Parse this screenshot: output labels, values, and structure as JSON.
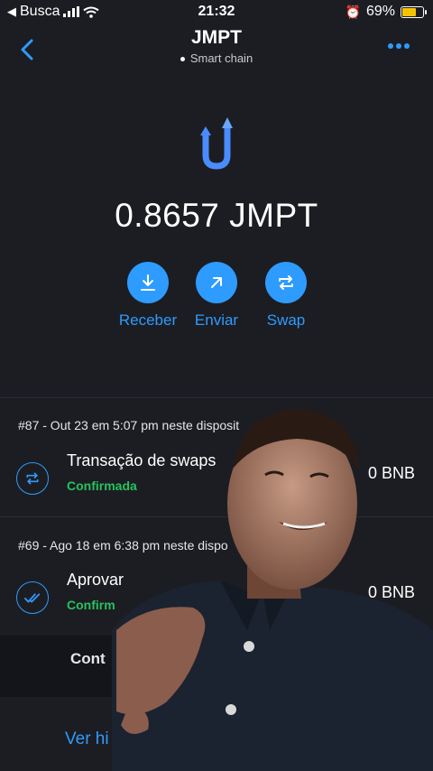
{
  "status_bar": {
    "carrier": "Busca",
    "time": "21:32",
    "battery": "69%"
  },
  "header": {
    "title": "JMPT",
    "subtitle": "Smart chain"
  },
  "balance": {
    "amount": "0.8657 JMPT"
  },
  "actions": {
    "receive": "Receber",
    "send": "Enviar",
    "swap": "Swap"
  },
  "transactions": [
    {
      "date": "#87 - Out 23 em 5:07 pm neste disposit",
      "title": "Transação de swaps",
      "status": "Confirmada",
      "amount": "0 BNB"
    },
    {
      "date": "#69 - Ago 18 em 6:38 pm neste dispo",
      "title": "Aprovar",
      "status": "Confirm",
      "amount": "0 BNB"
    }
  ],
  "footer": {
    "contact_label": "Cont",
    "history_link": "Ver hi"
  },
  "colors": {
    "background": "#1c1d22",
    "accent": "#2e9bff",
    "confirmed": "#27c25e",
    "battery": "#f5c400"
  }
}
